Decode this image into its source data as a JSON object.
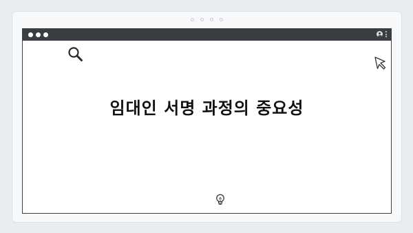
{
  "window": {
    "controls": [
      "close",
      "minimize",
      "maximize"
    ],
    "toolbar_icons": [
      "user-icon",
      "kebab-menu-icon"
    ]
  },
  "page": {
    "headline": "임대인 서명 과정의 중요성"
  },
  "icons": {
    "top_left": "search-icon",
    "top_right": "cursor-icon",
    "bottom": "lightbulb-icon"
  },
  "colors": {
    "background": "#e9ecf1",
    "titlebar": "#3a3d42",
    "text": "#111111"
  }
}
